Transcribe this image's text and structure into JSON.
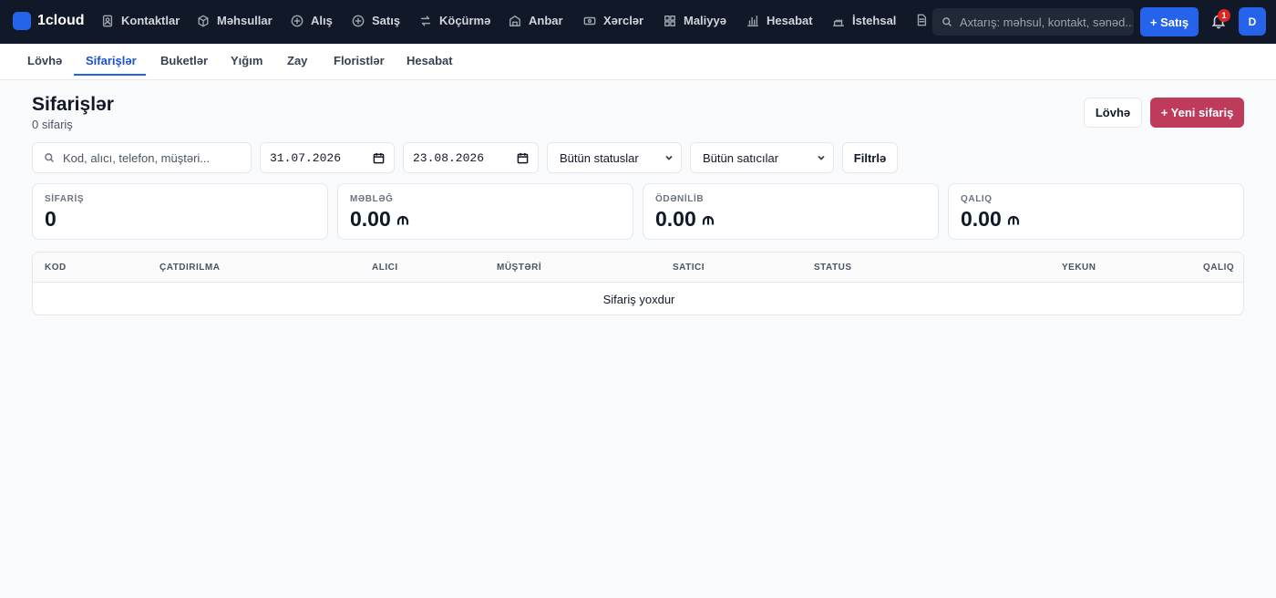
{
  "app": {
    "name": "1cloud"
  },
  "topnav": {
    "items": [
      {
        "label": "Kontaktlar",
        "icon": "contacts-icon"
      },
      {
        "label": "Məhsullar",
        "icon": "box-icon"
      },
      {
        "label": "Alış",
        "icon": "plus-circle-icon"
      },
      {
        "label": "Satış",
        "icon": "plus-circle-icon"
      },
      {
        "label": "Köçürmə",
        "icon": "transfer-icon"
      },
      {
        "label": "Anbar",
        "icon": "warehouse-icon"
      },
      {
        "label": "Xərclər",
        "icon": "banknote-icon"
      },
      {
        "label": "Maliyyə",
        "icon": "grid-icon"
      },
      {
        "label": "Hesabat",
        "icon": "bar-chart-icon"
      },
      {
        "label": "İstehsal",
        "icon": "factory-icon"
      }
    ],
    "search_placeholder": "Axtarış: məhsul, kontakt, sənəd...",
    "sale_button": "+ Satış",
    "notification_count": "1",
    "avatar_initial": "D"
  },
  "subnav": {
    "tabs": [
      {
        "label": "Lövhə"
      },
      {
        "label": "Sifarişlər",
        "active": true
      },
      {
        "label": "Buketlər"
      },
      {
        "label": "Yığım"
      },
      {
        "label": "Zay"
      },
      {
        "label": "Floristlər"
      },
      {
        "label": "Hesabat"
      }
    ]
  },
  "page": {
    "title": "Sifarişlər",
    "subtitle": "0 sifariş",
    "board_button": "Lövhə",
    "new_order_button": "+ Yeni sifariş"
  },
  "filters": {
    "search_placeholder": "Kod, alıcı, telefon, müştəri...",
    "date_from": "31.07.2026",
    "date_to": "23.08.2026",
    "status_select": "Bütün statuslar",
    "seller_select": "Bütün satıcılar",
    "filter_button": "Filtrlə"
  },
  "stats": [
    {
      "label": "SİFARİŞ",
      "value": "0",
      "currency": false
    },
    {
      "label": "MƏBLƏĞ",
      "value": "0.00",
      "currency": true
    },
    {
      "label": "ÖDƏNİLİB",
      "value": "0.00",
      "currency": true
    },
    {
      "label": "QALIQ",
      "value": "0.00",
      "currency": true
    }
  ],
  "table": {
    "columns": [
      "KOD",
      "ÇATDIRILMA",
      "ALICI",
      "MÜŞTƏRİ",
      "SATICI",
      "STATUS",
      "YEKUN",
      "QALIQ"
    ],
    "empty_text": "Sifariş yoxdur"
  },
  "colors": {
    "topbar_bg": "#111827",
    "primary": "#2563eb",
    "accent": "#be3b5c",
    "page_bg": "#f9fafb"
  }
}
